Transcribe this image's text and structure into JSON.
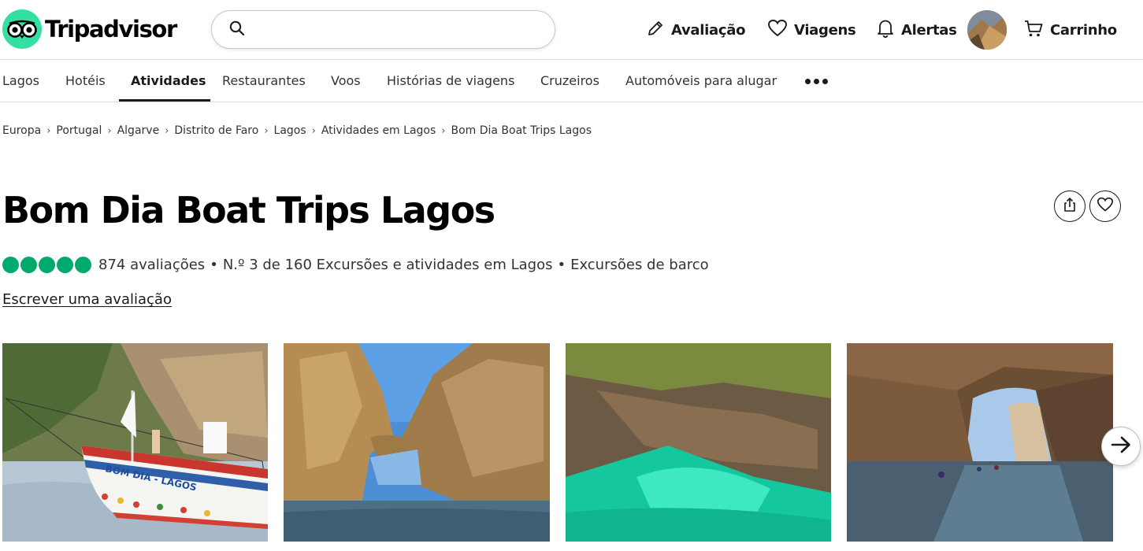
{
  "header": {
    "brand": "Tripadvisor",
    "search": {
      "value": "",
      "placeholder": ""
    },
    "nav": {
      "review": "Avaliação",
      "trips": "Viagens",
      "alerts": "Alertas",
      "cart": "Carrinho"
    },
    "brand_color": "#34e0a1"
  },
  "subnav": {
    "items": [
      "Lagos",
      "Hotéis",
      "Atividades",
      "Restaurantes",
      "Voos",
      "Histórias de viagens",
      "Cruzeiros",
      "Automóveis para alugar"
    ],
    "active": "Atividades"
  },
  "breadcrumb": [
    "Europa",
    "Portugal",
    "Algarve",
    "Distrito de Faro",
    "Lagos",
    "Atividades em Lagos",
    "Bom Dia Boat Trips Lagos"
  ],
  "listing": {
    "title": "Bom Dia Boat Trips Lagos",
    "rating_bubbles": 5,
    "rating_color": "#00aa6c",
    "reviews": "874 avaliações",
    "ranking": "N.º 3 de 160 Excursões e atividades em Lagos",
    "category": "Excursões de barco",
    "write_review": "Escrever uma avaliação"
  },
  "photos": [
    {
      "subject": "sailboat-bom-dia-lagos",
      "boat_lettering": "BOM DIA - LAGOS"
    },
    {
      "subject": "rock-arch-coast"
    },
    {
      "subject": "turquoise-sea-cave"
    },
    {
      "subject": "cave-arch-kayakers"
    }
  ]
}
